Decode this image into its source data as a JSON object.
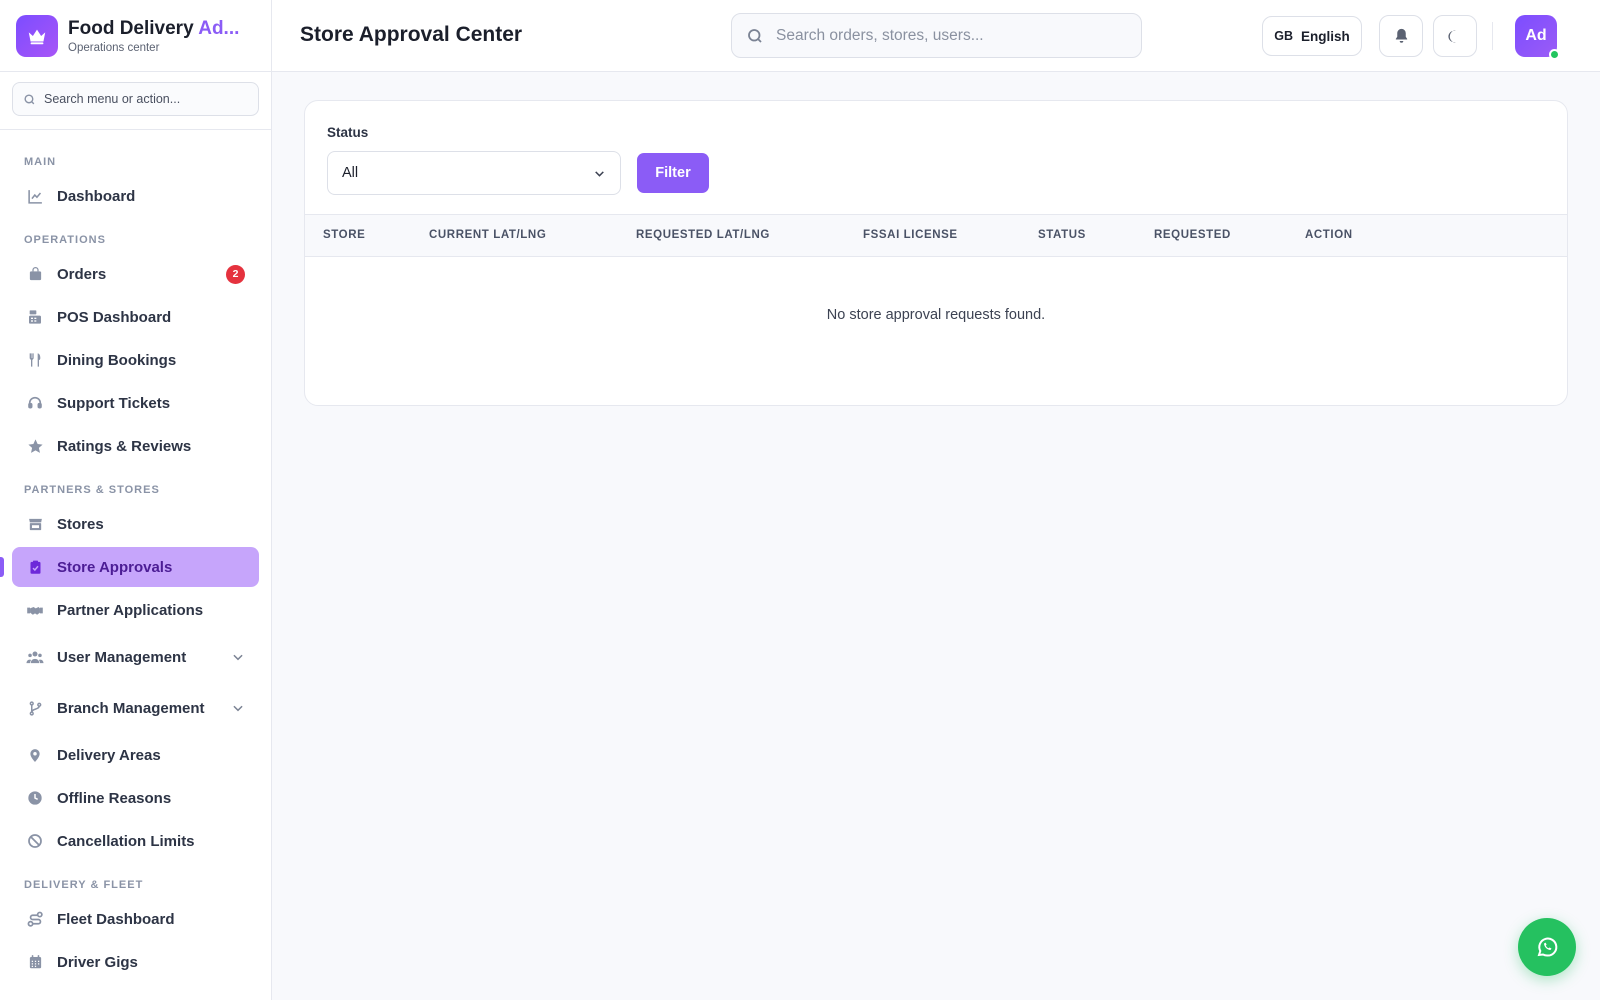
{
  "brand": {
    "title_main": "Food Delivery ",
    "title_accent": "Ad...",
    "subtitle": "Operations center"
  },
  "sidebar": {
    "search_placeholder": "Search menu or action...",
    "sections": {
      "main": "MAIN",
      "operations": "OPERATIONS",
      "partners": "PARTNERS & STORES",
      "fleet": "DELIVERY & FLEET"
    },
    "items": {
      "dashboard": "Dashboard",
      "orders": "Orders",
      "orders_badge": "2",
      "pos": "POS Dashboard",
      "dining": "Dining Bookings",
      "support": "Support Tickets",
      "ratings": "Ratings & Reviews",
      "stores": "Stores",
      "store_approvals": "Store Approvals",
      "partner_apps": "Partner Applications",
      "user_mgmt": "User Management",
      "branch_mgmt": "Branch Management",
      "delivery_areas": "Delivery Areas",
      "offline_reasons": "Offline Reasons",
      "cancellation": "Cancellation Limits",
      "fleet_dashboard": "Fleet Dashboard",
      "driver_gigs": "Driver Gigs"
    },
    "active_item": "Store Approvals"
  },
  "header": {
    "title": "Store Approval Center",
    "search_placeholder": "Search orders, stores, users...",
    "lang_flag": "GB",
    "lang_label": "English",
    "avatar_initials": "Ad"
  },
  "filter": {
    "label": "Status",
    "selected": "All",
    "button": "Filter"
  },
  "table": {
    "columns": [
      "STORE",
      "CURRENT LAT/LNG",
      "REQUESTED LAT/LNG",
      "FSSAI LICENSE",
      "STATUS",
      "REQUESTED",
      "ACTION"
    ],
    "empty_message": "No store approval requests found."
  },
  "colors": {
    "accent": "#8b5cf6",
    "active_bg": "#c6a5fb",
    "badge": "#e5323e",
    "whatsapp": "#25c160"
  }
}
